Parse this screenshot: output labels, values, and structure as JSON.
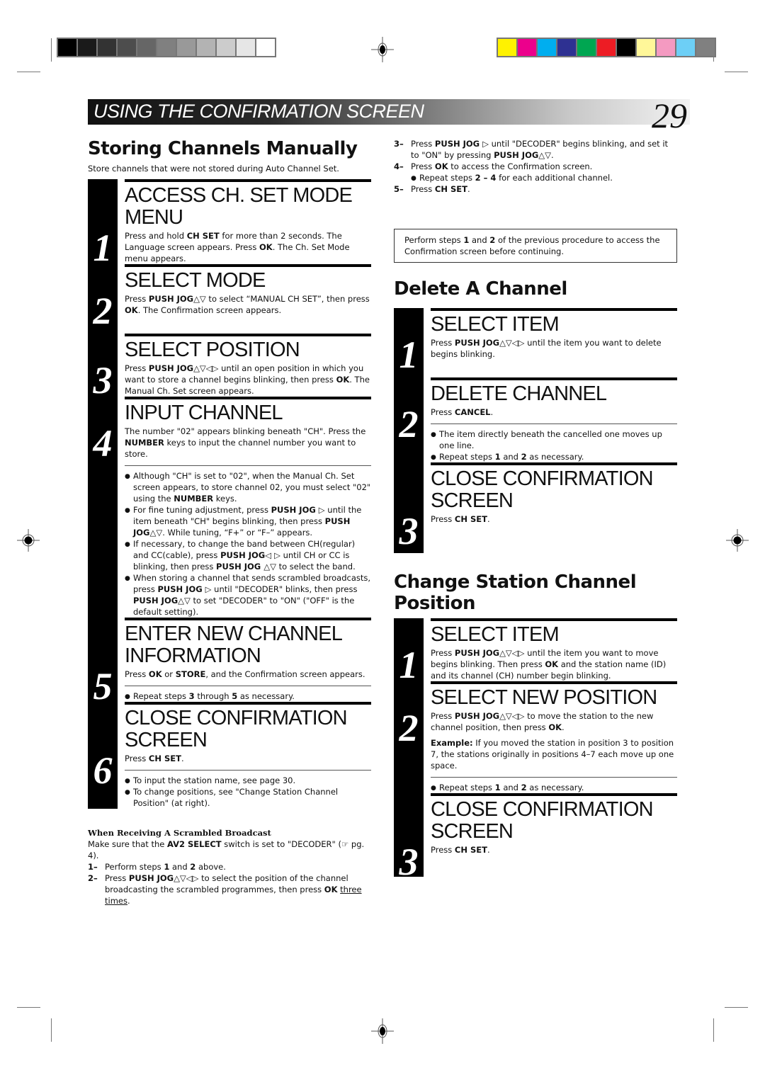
{
  "header": {
    "banner_title": "USING THE CONFIRMATION SCREEN",
    "page_number": "29"
  },
  "print_marks": {
    "grayscale_swatches": [
      "#000000",
      "#1a1a1a",
      "#333333",
      "#4d4d4d",
      "#666666",
      "#808080",
      "#999999",
      "#b3b3b3",
      "#cccccc",
      "#e6e6e6",
      "#ffffff"
    ],
    "color_swatches": [
      "#fff200",
      "#ec008c",
      "#00aeef",
      "#2e3192",
      "#00a651",
      "#ed1c24",
      "#000000",
      "#fff799",
      "#f49ac1",
      "#6dcff6",
      "#808080"
    ]
  },
  "storing": {
    "title": "Storing Channels Manually",
    "intro": "Store channels that were not stored during Auto Channel Set.",
    "steps": [
      {
        "num": "1",
        "title": "ACCESS CH. SET MODE MENU",
        "body": [
          "Press and hold ",
          "CH SET",
          " for more than 2 seconds. The Language screen appears. Press ",
          "OK",
          ". The Ch. Set Mode menu appears."
        ]
      },
      {
        "num": "2",
        "title": "SELECT MODE",
        "body": [
          "Press ",
          "PUSH JOG△▽",
          " to select “MANUAL CH SET”, then press ",
          "OK",
          ". The Confirmation screen appears."
        ]
      },
      {
        "num": "3",
        "title": "SELECT POSITION",
        "body": [
          "Press ",
          "PUSH JOG△▽◁▷",
          " until an open position in which you want to store a channel begins blinking, then press ",
          "OK",
          ". The Manual Ch. Set screen appears."
        ]
      },
      {
        "num": "4",
        "title": "INPUT CHANNEL",
        "body": [
          "The number \"02\" appears blinking beneath \"CH\". Press the ",
          "NUMBER",
          " keys to input the channel number you want to store."
        ],
        "notes": [
          [
            "Although \"CH\" is set to \"02\", when the Manual Ch. Set screen appears, to store channel 02, you must select \"02\" using the ",
            "NUMBER",
            " keys."
          ],
          [
            "For fine tuning adjustment, press ",
            "PUSH JOG ▷",
            " until the item beneath \"CH\" begins blinking, then press ",
            "PUSH JOG△▽",
            ". While tuning, “F+” or “F–” appears."
          ],
          [
            "If necessary, to change the band between CH(regular) and CC(cable), press ",
            "PUSH JOG◁ ▷",
            " until CH or CC is blinking, then press ",
            "PUSH JOG △▽",
            "  to select the band."
          ],
          [
            "When storing a channel that sends scrambled broadcasts, press ",
            "PUSH JOG ▷",
            " until \"DECODER\" blinks, then press ",
            "PUSH JOG△▽",
            " to set \"DECODER\" to \"ON\" (\"OFF\" is the default setting)."
          ]
        ]
      },
      {
        "num": "5",
        "title": "ENTER NEW CHANNEL INFORMATION",
        "body": [
          "Press ",
          "OK",
          " or ",
          "STORE",
          ", and the Confirmation screen appears."
        ],
        "notes": [
          [
            "Repeat steps ",
            "3",
            " through ",
            "5",
            " as necessary."
          ]
        ]
      },
      {
        "num": "6",
        "title": "CLOSE CONFIRMATION SCREEN",
        "body": [
          "Press ",
          "CH SET",
          "."
        ],
        "notes": [
          [
            "To input the station name, see page 30."
          ],
          [
            "To change positions, see \"Change Station Channel Position\" (at right)."
          ]
        ]
      }
    ]
  },
  "scrambled": {
    "heading": "When Receiving A Scrambled Broadcast",
    "intro": [
      "Make sure that the ",
      "AV2 SELECT",
      " switch is set to \"DECODER\" (☞ pg. 4)."
    ],
    "items": [
      {
        "n": "1–",
        "text": [
          "Perform steps ",
          "1",
          " and ",
          "2",
          " above."
        ]
      },
      {
        "n": "2–",
        "text": [
          "Press ",
          "PUSH JOG△▽◁▷",
          " to select the position of the channel broadcasting the scrambled programmes, then press ",
          "OK",
          " "
        ],
        "underlined": "three times",
        "tail": "."
      },
      {
        "n": "3–",
        "text": [
          "Press ",
          "PUSH JOG ▷",
          " until \"DECODER\" begins blinking, and set it to \"ON\" by pressing ",
          "PUSH JOG△▽",
          "."
        ]
      },
      {
        "n": "4–",
        "text": [
          "Press ",
          "OK",
          " to access the Confirmation screen."
        ],
        "sub": [
          "Repeat steps ",
          "2 – 4",
          " for each additional channel."
        ]
      },
      {
        "n": "5–",
        "text": [
          "Press ",
          "CH SET",
          "."
        ]
      }
    ]
  },
  "notice_box": [
    "Perform steps ",
    "1",
    " and ",
    "2",
    " of the previous procedure to access the Confirmation screen before continuing."
  ],
  "delete": {
    "title": "Delete A Channel",
    "steps": [
      {
        "num": "1",
        "title": "SELECT ITEM",
        "body": [
          "Press ",
          "PUSH JOG△▽◁▷",
          " until the item you want to delete begins blinking."
        ]
      },
      {
        "num": "2",
        "title": "DELETE CHANNEL",
        "body": [
          "Press ",
          "CANCEL",
          "."
        ],
        "notes": [
          [
            "The item directly beneath the cancelled one moves up one line."
          ],
          [
            "Repeat steps ",
            "1",
            " and ",
            "2",
            " as necessary."
          ]
        ]
      },
      {
        "num": "3",
        "title": "CLOSE CONFIRMATION SCREEN",
        "body": [
          "Press ",
          "CH SET",
          "."
        ]
      }
    ]
  },
  "change": {
    "title": "Change Station Channel Position",
    "steps": [
      {
        "num": "1",
        "title": "SELECT ITEM",
        "body": [
          "Press ",
          "PUSH JOG△▽◁▷",
          " until the item you want to move begins blinking. Then press ",
          "OK",
          " and the station name (ID) and its channel (CH) number begin blinking."
        ]
      },
      {
        "num": "2",
        "title": "SELECT NEW POSITION",
        "body": [
          "Press ",
          "PUSH JOG△▽◁▷",
          " to move the station to the new channel position, then press ",
          "OK",
          "."
        ],
        "example": [
          "Example:",
          "  If you moved the station in position 3 to position 7, the stations originally in positions 4–7 each move up one space."
        ],
        "notes": [
          [
            "Repeat steps ",
            "1",
            " and ",
            "2",
            " as necessary."
          ]
        ]
      },
      {
        "num": "3",
        "title": "CLOSE CONFIRMATION SCREEN",
        "body": [
          "Press ",
          "CH SET",
          "."
        ]
      }
    ]
  }
}
